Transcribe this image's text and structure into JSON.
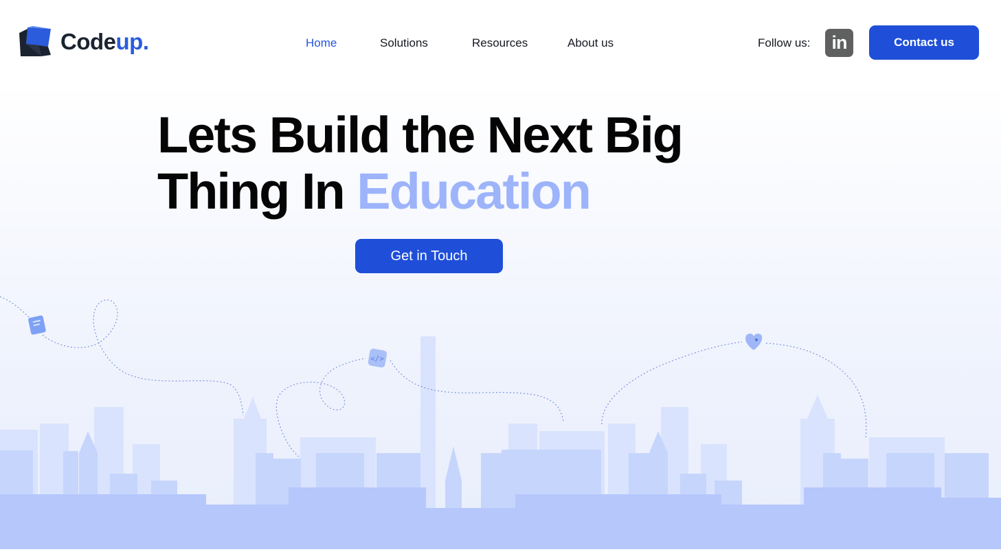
{
  "brand": {
    "name_part1": "Code",
    "name_part2": "up.",
    "colors": {
      "dark": "#1b2330",
      "blue": "#2a5cdb"
    }
  },
  "nav": {
    "items": [
      {
        "label": "Home",
        "active": true
      },
      {
        "label": "Solutions",
        "active": false
      },
      {
        "label": "Resources",
        "active": false
      },
      {
        "label": "About us",
        "active": false
      }
    ]
  },
  "social": {
    "follow_label": "Follow us:",
    "linkedin_glyph": "in",
    "linkedin_icon": "linkedin-icon"
  },
  "header": {
    "contact_label": "Contact us"
  },
  "hero": {
    "title_line1": "Lets Build the Next Big",
    "title_line2_prefix": "Thing In ",
    "title_line2_accent": "Education",
    "cta_label": "Get in Touch"
  },
  "illustration": {
    "icons": [
      "book-icon",
      "code-icon",
      "heart-icon"
    ],
    "scene": "city-skyline",
    "colors": {
      "primary_blue": "#1f4fd9",
      "accent_light_blue": "#9db4fb",
      "skyline_far": "#d7e2fd",
      "skyline_mid": "#c3d3fc",
      "skyline_near": "#aabff9"
    }
  }
}
